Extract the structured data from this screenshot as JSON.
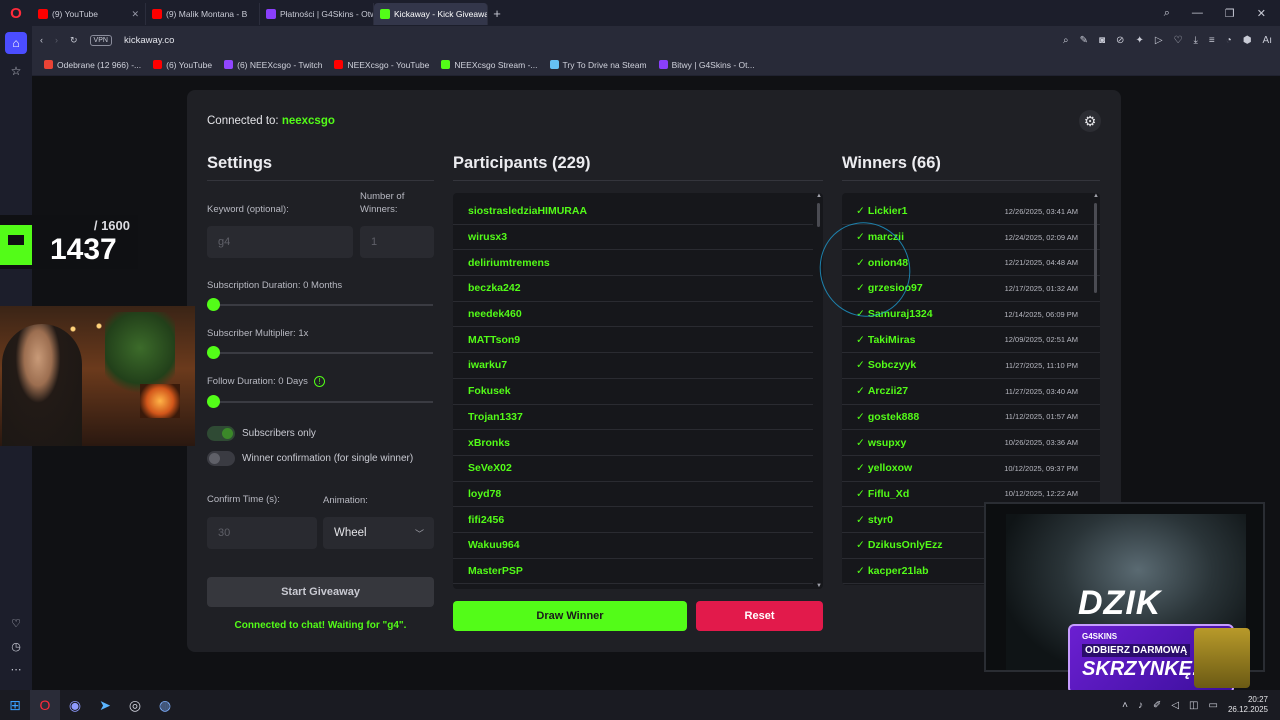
{
  "browser": {
    "tabs": [
      {
        "title": "(9) YouTube",
        "color": "#ff0000"
      },
      {
        "title": "(9) Malik Montana - B",
        "color": "#ff0000"
      },
      {
        "title": "Płatności | G4Skins - Otw",
        "color": "#8a3ffc"
      },
      {
        "title": "Kickaway - Kick Giveaway",
        "color": "#53fc18"
      }
    ],
    "url": "kickaway.co",
    "vpn_label": "VPN",
    "bookmarks": [
      {
        "label": "Odebrane (12 966) -...",
        "color": "#ea4335"
      },
      {
        "label": "(6) YouTube",
        "color": "#ff0000"
      },
      {
        "label": "(6) NEEXcsgo - Twitch",
        "color": "#9146ff"
      },
      {
        "label": "NEEXcsgo - YouTube",
        "color": "#ff0000"
      },
      {
        "label": "NEEXcsgo Stream -...",
        "color": "#53fc18"
      },
      {
        "label": "Try To Drive na Steam",
        "color": "#1b2838"
      },
      {
        "label": "Bitwy | G4Skins - Ot...",
        "color": "#8a3ffc"
      }
    ]
  },
  "page": {
    "connected_prefix": "Connected to:",
    "channel": "neexcsgo",
    "settings": {
      "title": "Settings",
      "keyword_label": "Keyword (optional):",
      "keyword_placeholder": "g4",
      "winners_label": "Number of Winners:",
      "winners_placeholder": "1",
      "sub_duration_label": "Subscription Duration: 0 Months",
      "sub_duration_value": 0,
      "sub_multiplier_label": "Subscriber Multiplier: 1x",
      "sub_multiplier_value": 1,
      "follow_duration_label": "Follow Duration: 0 Days",
      "follow_duration_value": 0,
      "subscribers_only_label": "Subscribers only",
      "winner_confirmation_label": "Winner confirmation (for single winner)",
      "confirm_time_label": "Confirm Time (s):",
      "confirm_time_placeholder": "30",
      "animation_label": "Animation:",
      "animation_value": "Wheel",
      "start_button": "Start Giveaway",
      "status": "Connected to chat! Waiting for \"g4\"."
    },
    "participants": {
      "title": "Participants (229)",
      "items": [
        "siostrasledziaHIMURAA",
        "wirusx3",
        "deliriumtremens",
        "beczka242",
        "needek460",
        "MATTson9",
        "iwarku7",
        "Fokusek",
        "Trojan1337",
        "xBronks",
        "SeVeX02",
        "loyd78",
        "fifi2456",
        "Wakuu964",
        "MasterPSP"
      ]
    },
    "winners": {
      "title": "Winners (66)",
      "items": [
        {
          "name": "Lickier1",
          "date": "12/26/2025, 03:41 AM"
        },
        {
          "name": "marczii",
          "date": "12/24/2025, 02:09 AM"
        },
        {
          "name": "onion48",
          "date": "12/21/2025, 04:48 AM"
        },
        {
          "name": "grzesioo97",
          "date": "12/17/2025, 01:32 AM"
        },
        {
          "name": "Samuraj1324",
          "date": "12/14/2025, 06:09 PM"
        },
        {
          "name": "TakiMiras",
          "date": "12/09/2025, 02:51 AM"
        },
        {
          "name": "Sobczyyk",
          "date": "11/27/2025, 11:10 PM"
        },
        {
          "name": "Arczii27",
          "date": "11/27/2025, 03:40 AM"
        },
        {
          "name": "gostek888",
          "date": "11/12/2025, 01:57 AM"
        },
        {
          "name": "wsupxy",
          "date": "10/26/2025, 03:36 AM"
        },
        {
          "name": "yelloxow",
          "date": "10/12/2025, 09:37 PM"
        },
        {
          "name": "Fiflu_Xd",
          "date": "10/12/2025, 12:22 AM"
        },
        {
          "name": "styr0",
          "date": ""
        },
        {
          "name": "DzikusOnlyEzz",
          "date": ""
        },
        {
          "name": "kacper21lab",
          "date": ""
        }
      ]
    },
    "draw_button": "Draw Winner",
    "reset_button": "Reset"
  },
  "overlay": {
    "counter_total": "/ 1600",
    "counter_current": "1437",
    "dzik_brand": "DZIK",
    "promo_logo": "G4SKINS",
    "promo_line1": "ODBIERZ DARMOWĄ",
    "promo_line2": "SKRZYNKĘ!"
  },
  "taskbar": {
    "time": "20:27",
    "date": "26.12.2025"
  },
  "colors": {
    "kick_green": "#53fc18",
    "reset_red": "#e21a4b",
    "accent_blue": "#4b4dff"
  }
}
